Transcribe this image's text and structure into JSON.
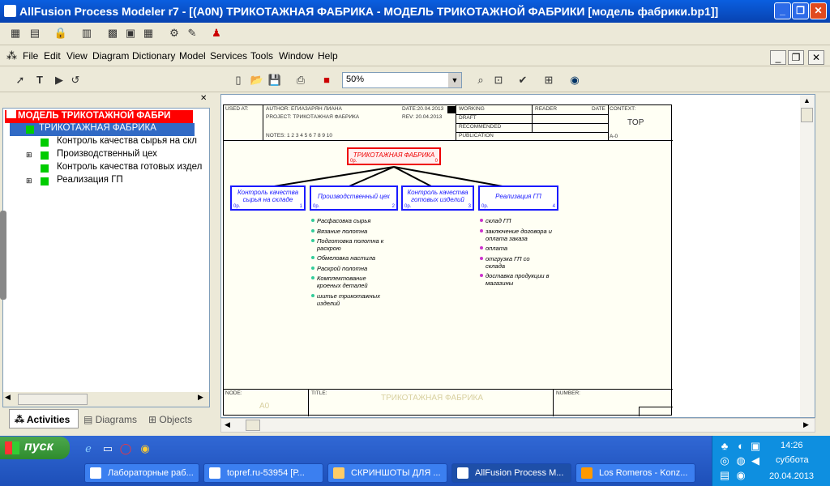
{
  "window": {
    "title": "AllFusion Process Modeler r7 - [(A0N) ТРИКОТАЖНАЯ ФАБРИКА - МОДЕЛЬ ТРИКОТАЖНОЙ ФАБРИКИ  [модель фабрики.bp1]]"
  },
  "menu": [
    "File",
    "Edit",
    "View",
    "Diagram",
    "Dictionary",
    "Model",
    "Services",
    "Tools",
    "Window",
    "Help"
  ],
  "toolbar": {
    "zoom": "50%"
  },
  "tree": {
    "root": "МОДЕЛЬ ТРИКОТАЖНОЙ ФАБРИ",
    "items": [
      "ТРИКОТАЖНАЯ ФАБРИКА",
      "Контроль качества  сырья на скл",
      "Производственный цех",
      "Контроль качества  готовых издел",
      "Реализация ГП"
    ]
  },
  "tabs": [
    "Activities",
    "Diagrams",
    "Objects"
  ],
  "header": {
    "used_at": "USED AT:",
    "author": "AUTHOR:  ЕГИАЗАРЯН ЛИАНА",
    "project": "PROJECT:  ТРИКОТАЖНАЯ ФАБРИКА",
    "date": "DATE:20.04.2013",
    "rev": "REV:  20.04.2013",
    "notes": "NOTES:  1  2  3  4  5  6  7  8  9  10",
    "working": "WORKING",
    "draft": "DRAFT",
    "recommended": "RECOMMENDED",
    "publication": "PUBLICATION",
    "reader": "READER",
    "date2": "DATE",
    "context": "CONTEXT:",
    "top": "TOP",
    "a0": "A-0"
  },
  "diagram": {
    "parent": "ТРИКОТАЖНАЯ ФАБРИКА",
    "parent_n": "0",
    "boxes": [
      {
        "label": "Контроль качества сырья на складе",
        "n": "1"
      },
      {
        "label": "Производственный цех",
        "n": "2"
      },
      {
        "label": "Контроль качества готовых изделий",
        "n": "3"
      },
      {
        "label": "Реализация ГП",
        "n": "4"
      }
    ],
    "box_cost": "0р.",
    "list2": [
      "Расфасовка сырья",
      "Вязание  полотна",
      "Подготовка  полотна к раскрою",
      "Обмеловка  настила",
      "Раскрой полотна",
      "Комплектование кроеных    деталей",
      "шитье  трикотажных изделий"
    ],
    "list4": [
      "склад ГП",
      "заключение договора и оплата заказа",
      "оплата",
      "отгрузка ГП  со склада",
      "доставка продукции в магазины"
    ]
  },
  "footer": {
    "node_label": "NODE:",
    "node": "A0",
    "title_label": "TITLE:",
    "title": "ТРИКОТАЖНАЯ ФАБРИКА",
    "number_label": "NUMBER:"
  },
  "taskbar": {
    "start": "пуск",
    "tasks": [
      "Лабораторные раб...",
      "topref.ru-53954 [Р...",
      "СКРИНШОТЫ ДЛЯ ...",
      "AllFusion Process M...",
      "Los Romeros - Konz..."
    ],
    "time": "14:26",
    "day": "суббота",
    "date": "20.04.2013"
  }
}
